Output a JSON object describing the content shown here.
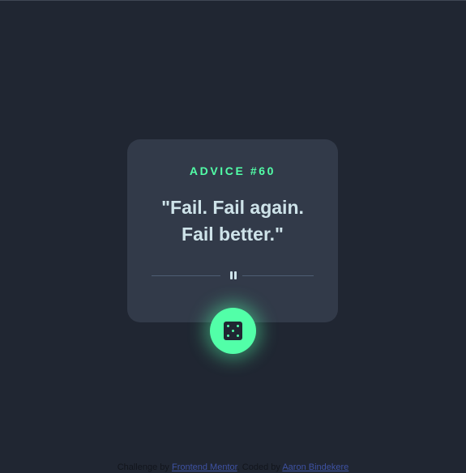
{
  "advice": {
    "id_label": "ADVICE #60",
    "quote_line1": "\"Fail. Fail again.",
    "quote_line2": "Fail better.\""
  },
  "dice_button": {
    "icon": "dice-icon"
  },
  "divider": {
    "icon": "pause-icon"
  },
  "footer": {
    "prefix": "Challenge by",
    "link1": "Frontend Mentor",
    "middle": ". Coded by",
    "link2": "Aaron Bindekere"
  },
  "colors": {
    "background": "#202632",
    "card": "#323a49",
    "accent": "#52ffa8",
    "text": "#cee3e9",
    "divider": "#4f5d74",
    "link": "#3e52a3"
  }
}
